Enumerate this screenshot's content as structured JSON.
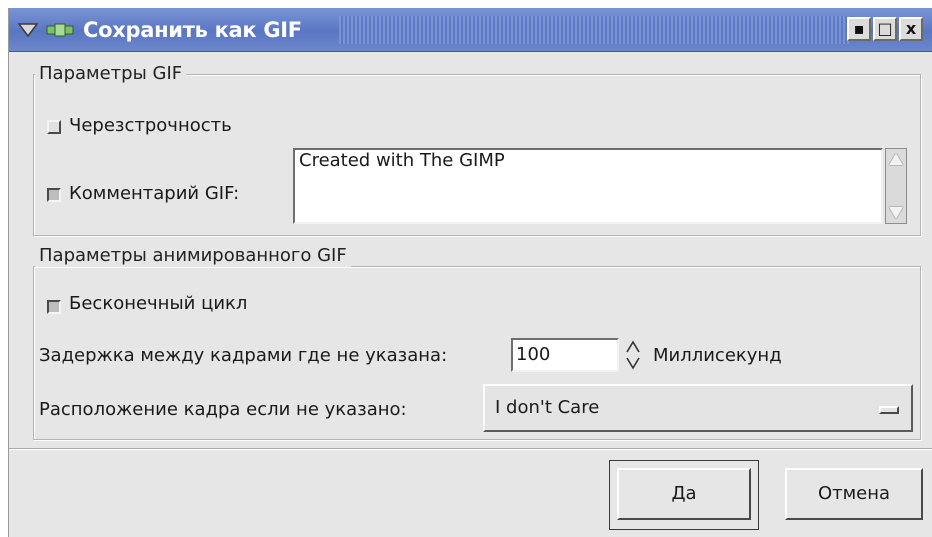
{
  "window": {
    "title": "Сохранить как GIF",
    "controls": {
      "minimize": "▪",
      "maximize": "□",
      "close": "x"
    }
  },
  "gif_options": {
    "legend": "Параметры GIF",
    "interlace": {
      "label": "Черезстрочность",
      "checked": false
    },
    "comment": {
      "label": "Комментарий GIF:",
      "checked": true,
      "value": "Created with The GIMP"
    }
  },
  "anim_options": {
    "legend": "Параметры анимированного GIF",
    "loop": {
      "label": "Бесконечный цикл",
      "checked": true
    },
    "delay": {
      "label": "Задержка между кадрами где не указана:",
      "value": "100",
      "unit": "Миллисекунд"
    },
    "dispose": {
      "label": "Расположение кадра если не указано:",
      "selected": "I don't Care"
    }
  },
  "buttons": {
    "ok": "Да",
    "cancel": "Отмена"
  },
  "colors": {
    "titlebar": "#5a76c2",
    "background": "#e6e6e6"
  }
}
